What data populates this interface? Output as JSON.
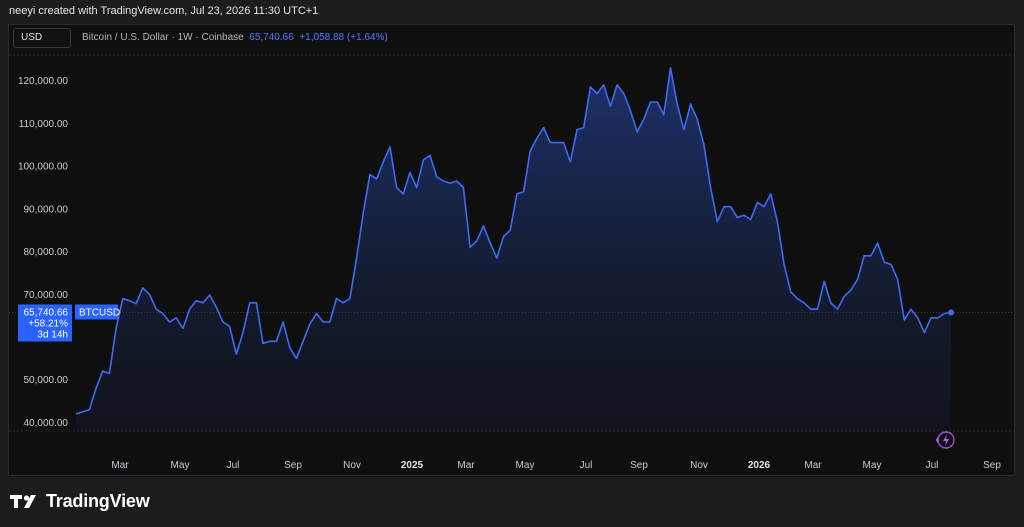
{
  "header": {
    "caption": "neeyi created with TradingView.com, Jul 23, 2026 11:30 UTC+1"
  },
  "toolbar": {
    "currency": "USD"
  },
  "legend": {
    "symbol_desc": "Bitcoin / U.S. Dollar · 1W · Coinbase",
    "last_price": "65,740.66",
    "change": "+1,058.88 (+1.64%)"
  },
  "price_tag": {
    "symbol": "BTCUSD",
    "price": "65,740.66",
    "change_pct": "+58.21%",
    "countdown": "3d 14h"
  },
  "footer": {
    "brand": "TradingView"
  },
  "colors": {
    "line": "#3c6cf5",
    "tag": "#2962ff",
    "grid": "#2a2a2e",
    "background": "#0f0f0f"
  },
  "icons": {
    "tag_icon": "flash-icon"
  },
  "chart_data": {
    "type": "area",
    "ylim": [
      38000,
      126000
    ],
    "yticks": [
      40000,
      50000,
      60000,
      70000,
      80000,
      90000,
      100000,
      110000,
      120000
    ],
    "ytick_labels": [
      "40,000.00",
      "50,000.00",
      "60,000.00",
      "70,000.00",
      "80,000.00",
      "90,000.00",
      "100,000.00",
      "110,000.00",
      "120,000.00"
    ],
    "xtick_labels": [
      "Mar",
      "May",
      "Jul",
      "Sep",
      "Nov",
      "2025",
      "Mar",
      "May",
      "Jul",
      "Sep",
      "Nov",
      "2026",
      "Mar",
      "May",
      "Jul",
      "Sep"
    ],
    "xtick_bold": [
      false,
      false,
      false,
      false,
      false,
      true,
      false,
      false,
      false,
      false,
      false,
      true,
      false,
      false,
      false,
      false
    ],
    "series": [
      {
        "values": [
          42000,
          42500,
          43000,
          48000,
          52000,
          51500,
          62000,
          69000,
          68500,
          67800,
          71500,
          70000,
          66500,
          65500,
          63500,
          64500,
          62000,
          66500,
          68500,
          68000,
          69800,
          67000,
          63500,
          62500,
          56000,
          61000,
          68000,
          68000,
          58500,
          59000,
          59000,
          63500,
          57500,
          55000,
          59000,
          63000,
          65500,
          63500,
          63500,
          69000,
          68000,
          69000,
          78500,
          89000,
          98000,
          97000,
          101000,
          104500,
          95000,
          93500,
          98500,
          95000,
          101500,
          102500,
          97500,
          96500,
          96000,
          96500,
          95000,
          81000,
          82500,
          86000,
          82000,
          78500,
          83500,
          85000,
          93500,
          94000,
          103500,
          106500,
          109000,
          105500,
          105500,
          105500,
          101000,
          108500,
          109000,
          118500,
          117000,
          119000,
          114000,
          119000,
          117000,
          113000,
          108000,
          111000,
          115000,
          115000,
          112000,
          123000,
          114500,
          108500,
          114500,
          111000,
          105000,
          95000,
          87000,
          90500,
          90500,
          88000,
          88500,
          87500,
          91500,
          90500,
          93500,
          87000,
          77000,
          70500,
          69000,
          68000,
          66500,
          66500,
          73000,
          68000,
          66500,
          69500,
          71000,
          73500,
          79000,
          79000,
          82000,
          77500,
          77000,
          73500,
          64000,
          66500,
          64500,
          61000,
          64500,
          64500,
          65500,
          65740.66
        ]
      }
    ]
  }
}
